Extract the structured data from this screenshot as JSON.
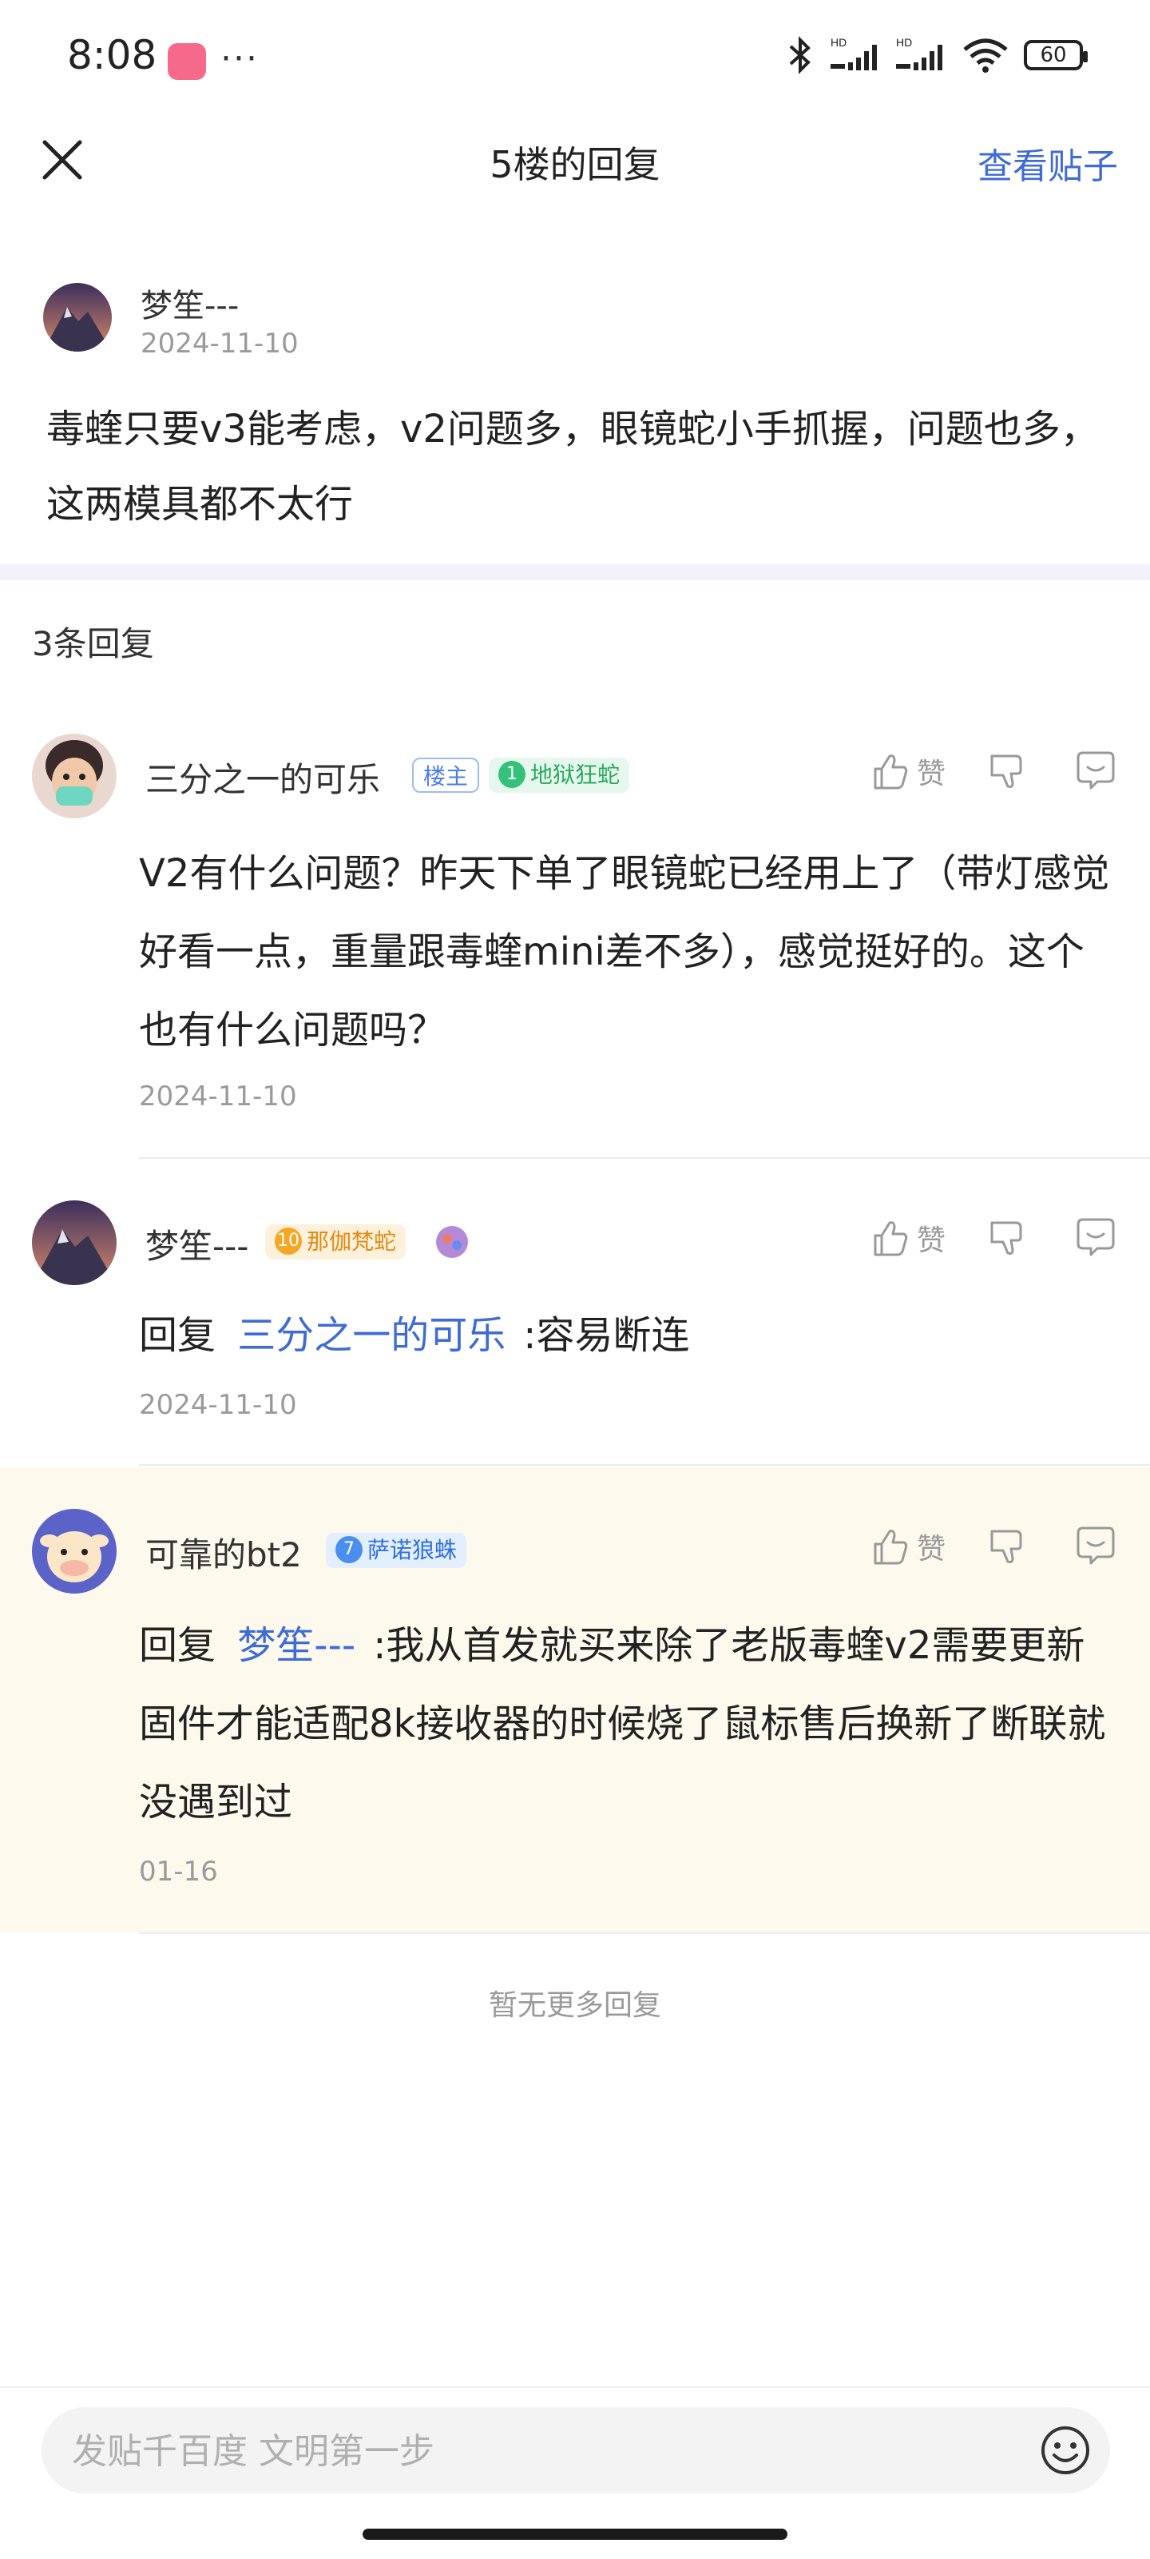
{
  "status_bar": {
    "time": "8:08",
    "battery": "60"
  },
  "nav": {
    "title": "5楼的回复",
    "view_post": "查看贴子"
  },
  "post": {
    "author": "梦笙---",
    "date": "2024-11-10",
    "content": "毒蝰只要v3能考虑，v2问题多，眼镜蛇小手抓握，问题也多，这两模具都不太行"
  },
  "reply_count": "3条回复",
  "actions": {
    "like_label": "赞"
  },
  "replies": [
    {
      "author": "三分之一的可乐",
      "host_badge": "楼主",
      "level": "1",
      "title": "地狱狂蛇",
      "content": "V2有什么问题？昨天下单了眼镜蛇已经用上了（带灯感觉好看一点，重量跟毒蝰mini差不多），感觉挺好的。这个也有什么问题吗？",
      "date": "2024-11-10"
    },
    {
      "author": "梦笙---",
      "level": "10",
      "title": "那伽梵蛇",
      "reply_prefix": "回复",
      "mention": "三分之一的可乐",
      "content": ":容易断连",
      "date": "2024-11-10"
    },
    {
      "author": "可靠的bt2",
      "level": "7",
      "title": "萨诺狼蛛",
      "reply_prefix": "回复",
      "mention": "梦笙---",
      "content": ":我从首发就买来除了老版毒蝰v2需要更新固件才能适配8k接收器的时候烧了鼠标售后换新了断联就没遇到过",
      "date": "01-16"
    }
  ],
  "no_more": "暂无更多回复",
  "input": {
    "placeholder": "发贴千百度 文明第一步"
  },
  "colors": {
    "link": "#3f6bd6",
    "highlight": "#fdf9ec",
    "level1": "#34c27a",
    "level10": "#f5a623",
    "level7": "#4a8ff0"
  }
}
